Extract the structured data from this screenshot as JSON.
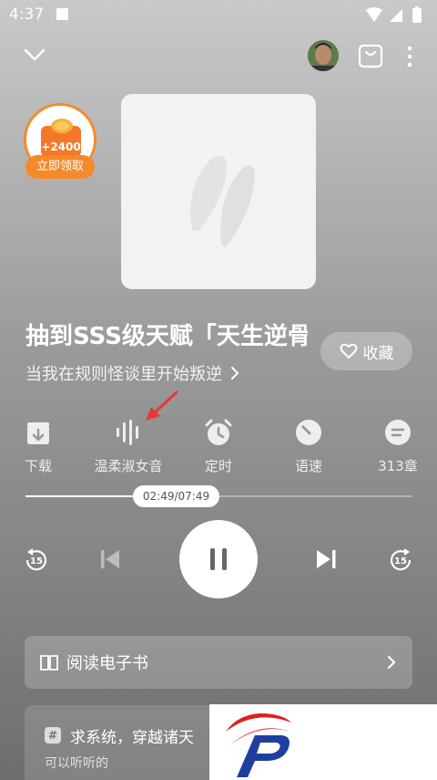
{
  "status_bar": {
    "time": "4:37"
  },
  "promo": {
    "amount": "+2400",
    "label": "立即领取"
  },
  "book": {
    "title": "抽到SSS级天赋「天生逆骨",
    "subtitle": "当我在规则怪谈里开始叛逆",
    "favorite_label": "收藏"
  },
  "tools": [
    {
      "label": "下载",
      "icon": "download-icon"
    },
    {
      "label": "温柔淑女音",
      "icon": "voice-wave-icon"
    },
    {
      "label": "定时",
      "icon": "alarm-clock-icon"
    },
    {
      "label": "语速",
      "icon": "speed-dial-icon"
    },
    {
      "label": "313章",
      "icon": "chapter-list-icon"
    }
  ],
  "player": {
    "time": "02:49/07:49",
    "progress": 0.36,
    "skip_back_seconds": "15",
    "skip_forward_seconds": "15"
  },
  "ebook": {
    "label": "阅读电子书"
  },
  "recommendation": {
    "title": "求系统，穿越诸天",
    "subtitle": "可以听听的"
  },
  "colors": {
    "accent": "#f58a2b",
    "annotation_arrow": "#e53935"
  }
}
